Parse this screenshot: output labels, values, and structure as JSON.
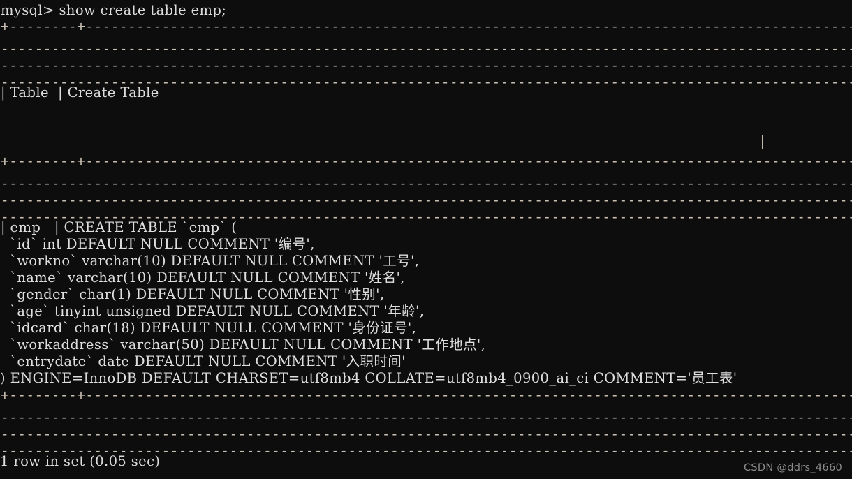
{
  "terminal": {
    "app": "mysql-client",
    "background_color": "#0d0d0d",
    "text_color": "#dcdcdc",
    "rule_color": "#c9bfb2",
    "prompt_line": "mysql> show create table emp;",
    "header_row": "| Table  | Create Table",
    "data_row_head": "| emp   | CREATE TABLE `emp` (",
    "columns": [
      "  `id` int DEFAULT NULL COMMENT '编号',",
      "  `workno` varchar(10) DEFAULT NULL COMMENT '工号',",
      "  `name` varchar(10) DEFAULT NULL COMMENT '姓名',",
      "  `gender` char(1) DEFAULT NULL COMMENT '性别',",
      "  `age` tinyint unsigned DEFAULT NULL COMMENT '年龄',",
      "  `idcard` char(18) DEFAULT NULL COMMENT '身份证号',",
      "  `workaddress` varchar(50) DEFAULT NULL COMMENT '工作地点',",
      "  `entrydate` date DEFAULT NULL COMMENT '入职时间'"
    ],
    "engine_line": ") ENGINE=InnoDB DEFAULT CHARSET=utf8mb4 COLLATE=utf8mb4_0900_ai_ci COMMENT='员工表'",
    "rule_segment_start": "+--------+----------------------------------------------------------------------------------------------------------------------",
    "rule_segment_middle": "---------------------------------------------------------------------------------------------------------------------------------------------------",
    "rule_segment_end": "--------------------------------------------------------------------------------------------------------------------------+",
    "trailing_pipe": "|",
    "status_line": "1 row in set (0.05 sec)"
  },
  "watermark": {
    "text": "CSDN @ddrs_4660"
  }
}
